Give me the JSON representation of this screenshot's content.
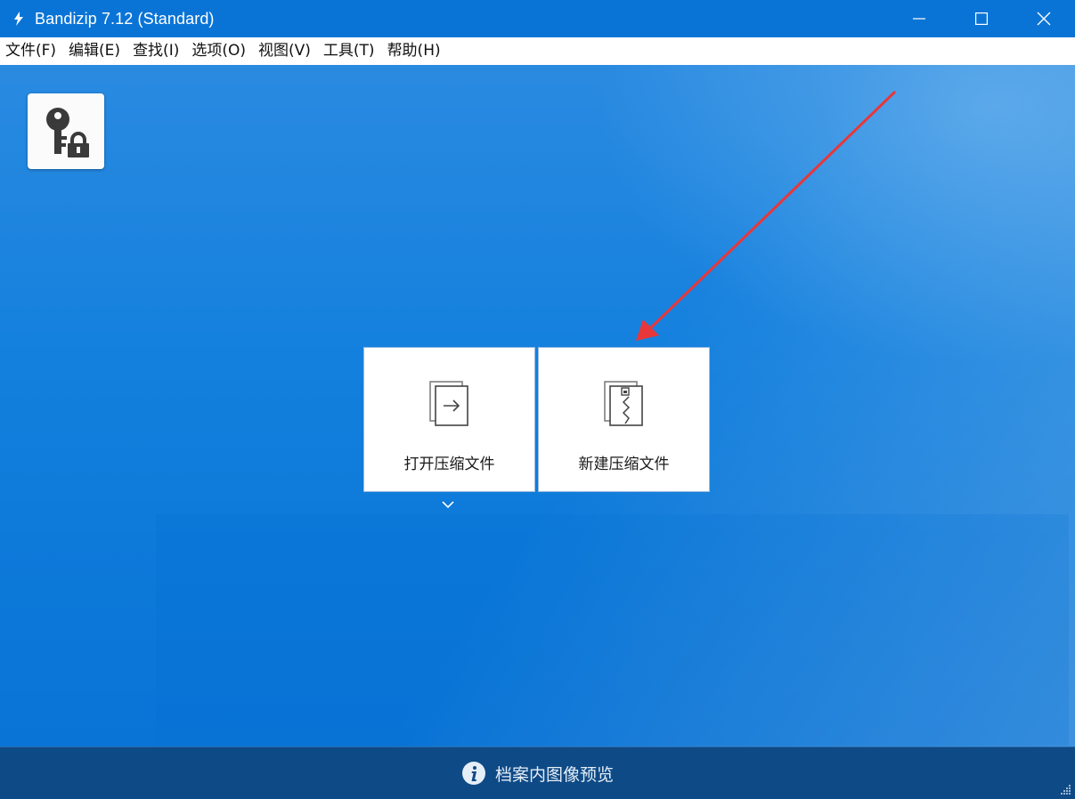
{
  "window": {
    "title": "Bandizip 7.12 (Standard)"
  },
  "menu": [
    "文件(F)",
    "编辑(E)",
    "查找(I)",
    "选项(O)",
    "视图(V)",
    "工具(T)",
    "帮助(H)"
  ],
  "tiles": {
    "open_archive": {
      "label": "打开压缩文件",
      "icon": "open-archive-icon"
    },
    "new_archive": {
      "label": "新建压缩文件",
      "icon": "zip-archive-icon"
    }
  },
  "password_tile": {
    "icon": "key-lock-icon"
  },
  "bottom_bar": {
    "preview_label": "档案内图像预览",
    "icon": "info-icon"
  },
  "colors": {
    "accent": "#0a74d6",
    "bottom": "#0e4a86",
    "annotation": "#e8373a"
  }
}
